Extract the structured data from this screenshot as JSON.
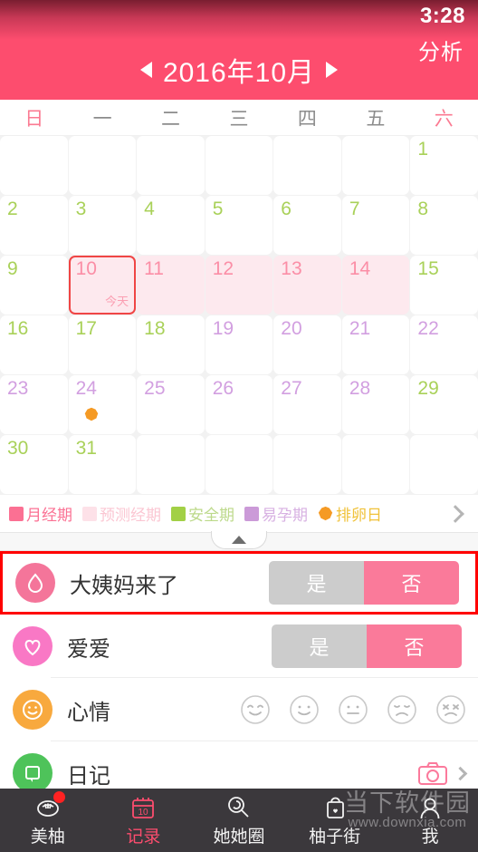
{
  "status": {
    "time": "3:28"
  },
  "header": {
    "prev_icon": "triangle-left-icon",
    "month_title": "2016年10月",
    "next_icon": "triangle-right-icon",
    "analyze_label": "分析",
    "bg_color": "#fd4d6e"
  },
  "weekdays": [
    {
      "label": "日",
      "weekend": true
    },
    {
      "label": "一",
      "weekend": false
    },
    {
      "label": "二",
      "weekend": false
    },
    {
      "label": "三",
      "weekend": false
    },
    {
      "label": "四",
      "weekend": false
    },
    {
      "label": "五",
      "weekend": false
    },
    {
      "label": "六",
      "weekend": true
    }
  ],
  "calendar": {
    "today_label": "今天",
    "cells": [
      {
        "day": "",
        "state": "empty"
      },
      {
        "day": "",
        "state": "empty"
      },
      {
        "day": "",
        "state": "empty"
      },
      {
        "day": "",
        "state": "empty"
      },
      {
        "day": "",
        "state": "empty"
      },
      {
        "day": "",
        "state": "empty"
      },
      {
        "day": "1",
        "state": "safe"
      },
      {
        "day": "2",
        "state": "safe"
      },
      {
        "day": "3",
        "state": "safe"
      },
      {
        "day": "4",
        "state": "safe"
      },
      {
        "day": "5",
        "state": "safe"
      },
      {
        "day": "6",
        "state": "safe"
      },
      {
        "day": "7",
        "state": "safe"
      },
      {
        "day": "8",
        "state": "safe"
      },
      {
        "day": "9",
        "state": "safe"
      },
      {
        "day": "10",
        "state": "today"
      },
      {
        "day": "11",
        "state": "pred"
      },
      {
        "day": "12",
        "state": "pred"
      },
      {
        "day": "13",
        "state": "pred"
      },
      {
        "day": "14",
        "state": "pred"
      },
      {
        "day": "15",
        "state": "safe"
      },
      {
        "day": "16",
        "state": "safe"
      },
      {
        "day": "17",
        "state": "safe"
      },
      {
        "day": "18",
        "state": "safe"
      },
      {
        "day": "19",
        "state": "fertile"
      },
      {
        "day": "20",
        "state": "fertile"
      },
      {
        "day": "21",
        "state": "fertile"
      },
      {
        "day": "22",
        "state": "fertile"
      },
      {
        "day": "23",
        "state": "fertile"
      },
      {
        "day": "24",
        "state": "fertile",
        "ovulation": true
      },
      {
        "day": "25",
        "state": "fertile"
      },
      {
        "day": "26",
        "state": "fertile"
      },
      {
        "day": "27",
        "state": "fertile"
      },
      {
        "day": "28",
        "state": "fertile"
      },
      {
        "day": "29",
        "state": "safe"
      },
      {
        "day": "30",
        "state": "safe"
      },
      {
        "day": "31",
        "state": "safe"
      },
      {
        "day": "",
        "state": "empty"
      },
      {
        "day": "",
        "state": "empty"
      },
      {
        "day": "",
        "state": "empty"
      },
      {
        "day": "",
        "state": "empty"
      },
      {
        "day": "",
        "state": "empty"
      }
    ]
  },
  "legend": {
    "items": [
      {
        "label": "月经期",
        "color": "#fb7093",
        "text_color": "#fb7093"
      },
      {
        "label": "预测经期",
        "color": "#fde1e8",
        "text_color": "#fbc6d2"
      },
      {
        "label": "安全期",
        "color": "#a2d046",
        "text_color": "#bcd98a"
      },
      {
        "label": "易孕期",
        "color": "#cb9ad8",
        "text_color": "#d7b0e2"
      },
      {
        "label": "排卵日",
        "color": "#f59a24",
        "text_color": "#f0c23a",
        "icon": "flower-icon"
      }
    ],
    "chevron_icon": "chevron-right-icon"
  },
  "handle": {
    "icon": "triangle-up-icon"
  },
  "records": [
    {
      "icon": "blood-drop-icon",
      "icon_color": "#f4759a",
      "label": "大姨妈来了",
      "control": "toggle",
      "yes_label": "是",
      "no_label": "否",
      "selected": "否",
      "highlighted": true
    },
    {
      "icon": "heart-icon",
      "icon_color": "#f978c5",
      "label": "爱爱",
      "control": "toggle",
      "yes_label": "是",
      "no_label": "否",
      "selected": "否",
      "highlighted": false
    },
    {
      "icon": "smiley-icon",
      "icon_color": "#f8a93e",
      "label": "心情",
      "control": "moods",
      "moods": [
        "mood-very-happy-icon",
        "mood-happy-icon",
        "mood-neutral-icon",
        "mood-sad-icon",
        "mood-crying-icon"
      ],
      "highlighted": false
    },
    {
      "icon": "diary-icon",
      "icon_color": "#4ec35a",
      "label": "日记",
      "control": "camera",
      "camera_icon": "camera-icon",
      "chevron_icon": "chevron-right-icon",
      "highlighted": false
    }
  ],
  "bottom_nav": {
    "items": [
      {
        "label": "美柚",
        "icon": "meiyou-icon",
        "active": false,
        "badge": true
      },
      {
        "label": "记录",
        "icon": "calendar-10-icon",
        "active": true,
        "badge": false
      },
      {
        "label": "她她圈",
        "icon": "lollipop-icon",
        "active": false,
        "badge": false
      },
      {
        "label": "柚子街",
        "icon": "shopping-bag-icon",
        "active": false,
        "badge": false
      },
      {
        "label": "我",
        "icon": "person-icon",
        "active": false,
        "badge": false
      }
    ],
    "active_color": "#fd4d6e"
  },
  "watermark": {
    "line1": "当下软件园",
    "line2": "www.downxia.com"
  }
}
